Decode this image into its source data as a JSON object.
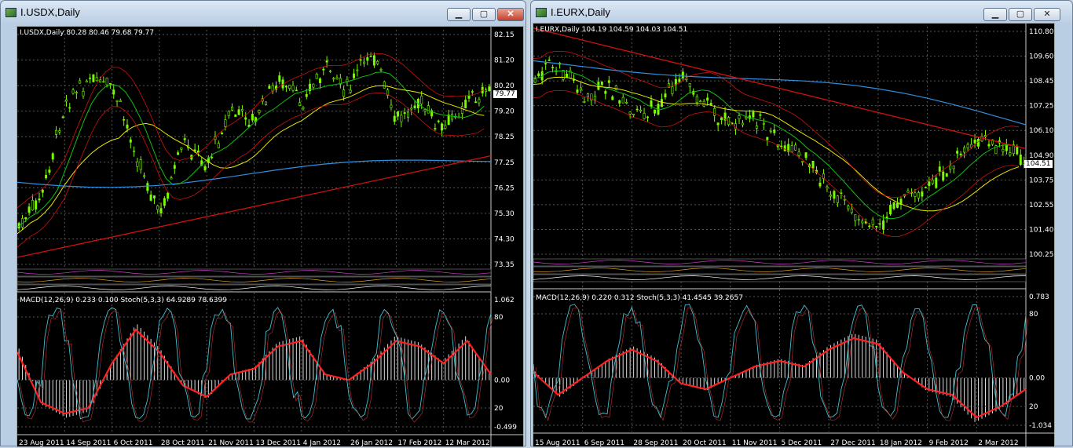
{
  "windows": [
    {
      "title": "I.USDX,Daily",
      "header": "I.USDX,Daily  80.28 80.46 79.68 79.77",
      "current_price": "79.77",
      "price_ticks": [
        "82.15",
        "81.20",
        "80.20",
        "79.20",
        "78.25",
        "77.25",
        "76.25",
        "75.30",
        "74.30",
        "73.35"
      ],
      "sub_ticks": [
        "1.062",
        "80",
        "0.00",
        "20",
        "-0.499"
      ],
      "indicator_label": "MACD(12,26,9) 0.233 0.100  Stoch(5,3,3) 64.9289 78.6399",
      "dates": [
        "23 Aug 2011",
        "14 Sep 2011",
        "6 Oct 2011",
        "28 Oct 2011",
        "21 Nov 2011",
        "13 Dec 2011",
        "4 Jan 2012",
        "26 Jan 2012",
        "17 Feb 2012",
        "12 Mar 2012"
      ]
    },
    {
      "title": "I.EURX,Daily",
      "header": "I.EURX,Daily  104.19 104.59 104.03 104.51",
      "current_price": "104.51",
      "price_ticks": [
        "110.80",
        "109.60",
        "108.45",
        "107.25",
        "106.10",
        "104.90",
        "103.75",
        "102.55",
        "101.40",
        "100.25"
      ],
      "sub_ticks": [
        "0.783",
        "80",
        "0.00",
        "20",
        "-1.034"
      ],
      "indicator_label": "MACD(12,26,9) 0.220 0.312  Stoch(5,3,3) 41.4545 39.2657",
      "dates": [
        "15 Aug 2011",
        "6 Sep 2011",
        "28 Sep 2011",
        "20 Oct 2011",
        "11 Nov 2011",
        "5 Dec 2011",
        "27 Dec 2011",
        "18 Jan 2012",
        "9 Feb 2012",
        "2 Mar 2012"
      ]
    }
  ],
  "button_labels": {
    "minimize": "▁",
    "maximize": "▢",
    "close": "✕"
  },
  "colors": {
    "candle": "#7cfc00",
    "ma_red": "#d01010",
    "ma_yellow": "#e8e800",
    "ma_green": "#10c010",
    "ma_blue": "#3090e0",
    "macd_signal": "#ff2020",
    "stoch": "#40c0d0"
  }
}
